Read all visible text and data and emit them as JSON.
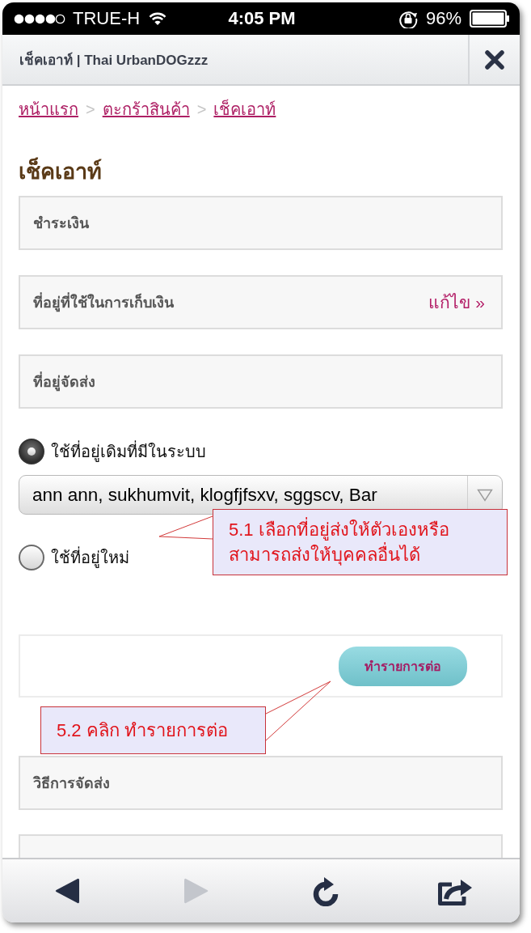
{
  "status_bar": {
    "carrier": "TRUE-H",
    "time": "4:05 PM",
    "battery": "96%"
  },
  "title_bar": {
    "title": "เช็คเอาท์ | Thai UrbanDOGzzz"
  },
  "breadcrumb": [
    {
      "kind": "link",
      "label": "หน้าแรก"
    },
    {
      "kind": "separator",
      "label": ">"
    },
    {
      "kind": "link",
      "label": "ตะกร้าสินค้า"
    },
    {
      "kind": "separator",
      "label": ">"
    },
    {
      "kind": "link",
      "label": "เช็คเอาท์"
    }
  ],
  "heading": "เช็คเอาท์",
  "steps": [
    {
      "kind": "titled",
      "title": "ชำระเงิน"
    },
    {
      "kind": "titled",
      "title": "ที่อยู่ที่ใช้ในการเก็บเงิน",
      "edit_link": "แก้ไข »"
    },
    {
      "kind": "titled",
      "title": "ที่อยู่จัดส่ง"
    }
  ],
  "shipping_options": [
    {
      "label": "ใช้ที่อยู่เดิมที่มีในระบบ",
      "selected": true,
      "address_select": "ann ann, sukhumvit, klogfjfsxv, sggscv, Bar"
    },
    {
      "label": "ใช้ที่อยู่ใหม่",
      "selected": false
    }
  ],
  "continue_button": "ทำรายการต่อ",
  "later_steps": [
    {
      "kind": "titled",
      "title": "วิธีการจัดส่ง"
    },
    {
      "kind": "cut_off"
    }
  ],
  "annotations": [
    {
      "lines": [
        "5.1 เลือกที่อยู่ส่งให้ตัวเองหรือ",
        "สามารถส่งให้บุคคลอื่นได้"
      ]
    },
    {
      "lines": [
        "5.2 คลิก ทำรายการต่อ"
      ]
    }
  ],
  "toolbar": [
    {
      "kind": "back",
      "disabled": false
    },
    {
      "kind": "forward",
      "disabled": true
    },
    {
      "kind": "reload",
      "disabled": false
    },
    {
      "kind": "share",
      "disabled": false
    }
  ]
}
